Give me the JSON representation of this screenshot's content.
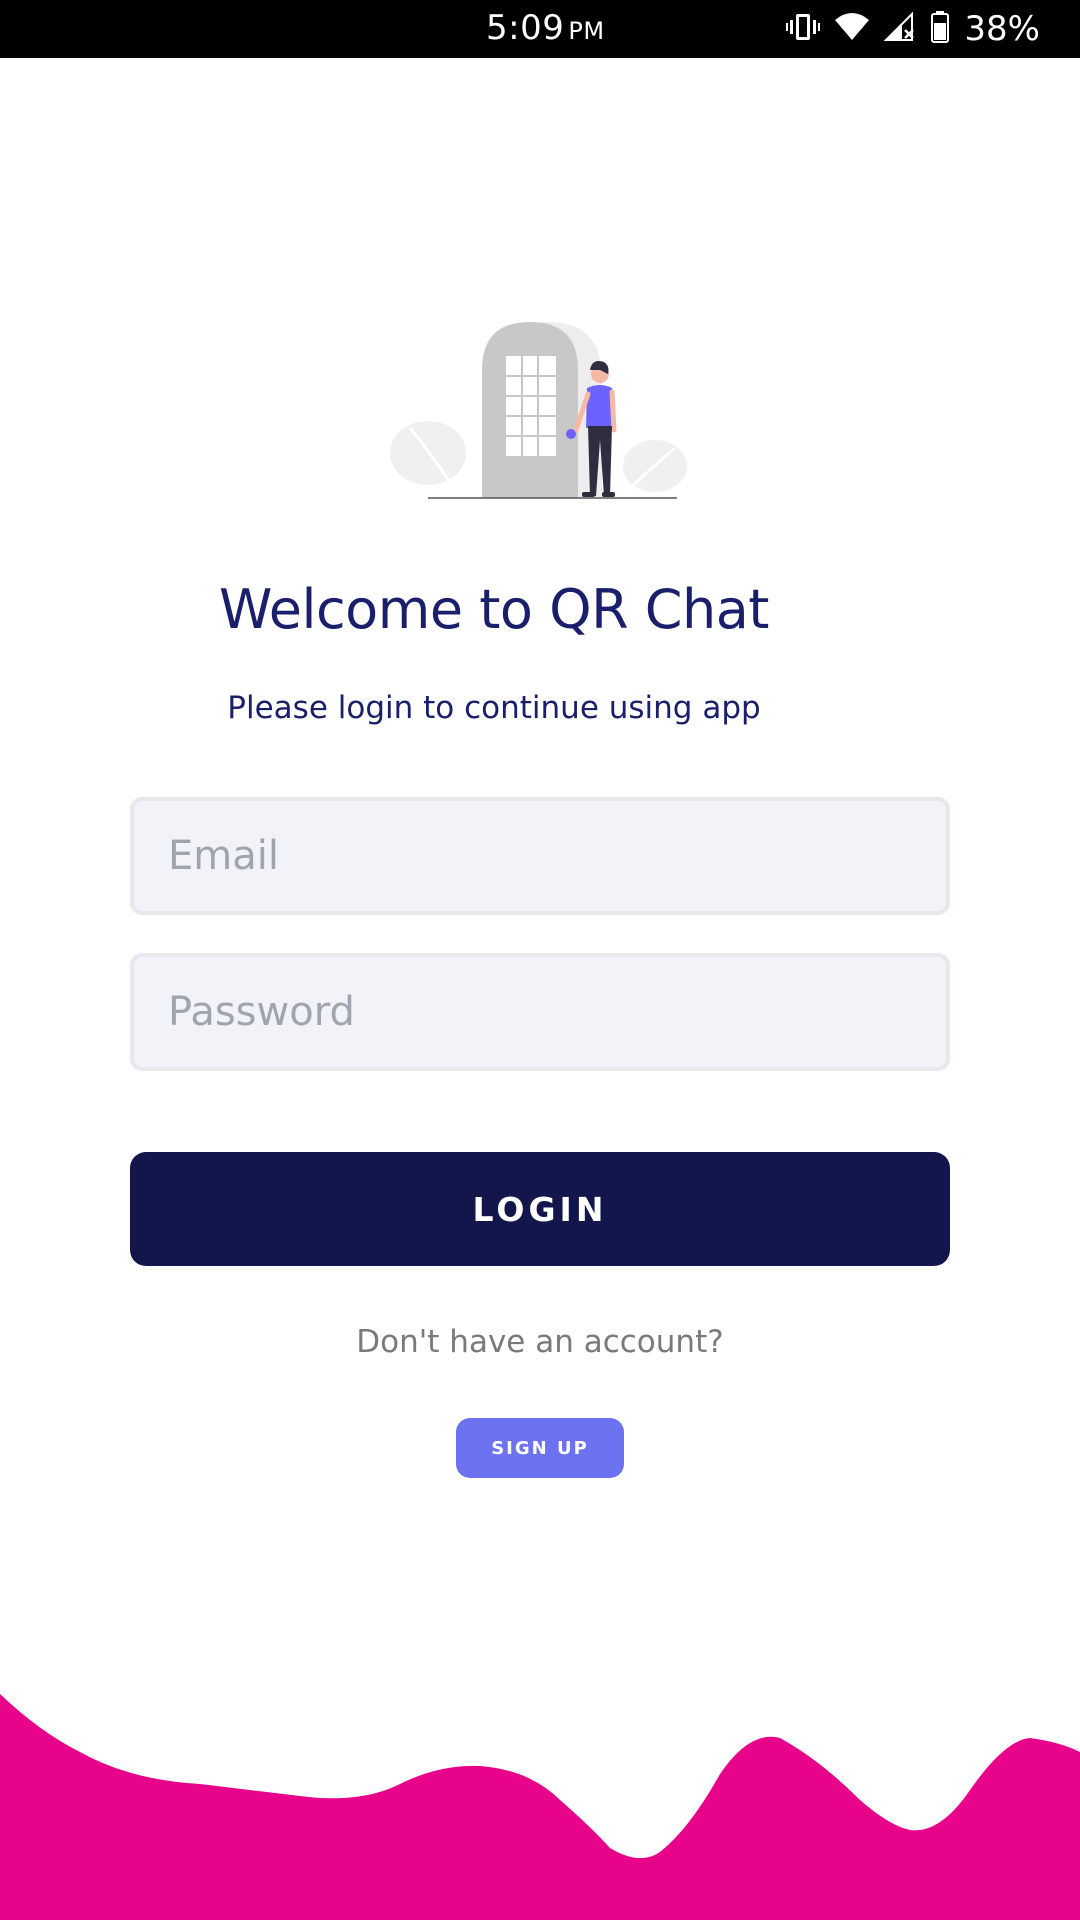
{
  "status_bar": {
    "time": "5:09",
    "ampm": "PM",
    "battery": "38%",
    "icons": [
      "vibrate-icon",
      "wifi-icon",
      "signal-icon",
      "battery-icon"
    ]
  },
  "welcome": {
    "title": "Welcome to QR Chat",
    "subtitle": "Please login to continue using app"
  },
  "form": {
    "email_placeholder": "Email",
    "email_value": "",
    "password_placeholder": "Password",
    "password_value": "",
    "login_label": "LOGIN"
  },
  "signup": {
    "prompt": "Don't have an account?",
    "button_label": "SIGN UP"
  },
  "colors": {
    "title": "#1a1f6b",
    "login_button": "#12164b",
    "signup_button": "#6c72f0",
    "wave": "#e8048a",
    "field_background": "#f1f3f8"
  }
}
